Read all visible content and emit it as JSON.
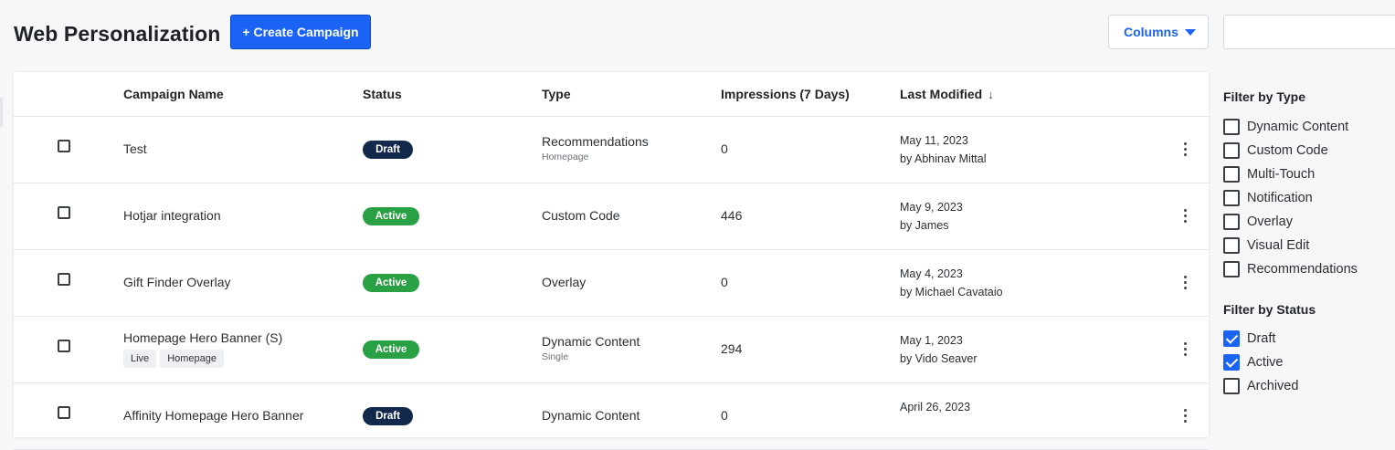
{
  "header": {
    "title": "Web Personalization",
    "create_label": "+ Create Campaign",
    "columns_label": "Columns",
    "search": {
      "value": "",
      "placeholder": ""
    }
  },
  "table": {
    "columns": {
      "name": "Campaign Name",
      "status": "Status",
      "type": "Type",
      "impressions": "Impressions (7 Days)",
      "modified": "Last Modified"
    },
    "sort_icon": "arrow-down-icon",
    "rows": [
      {
        "name": "Test",
        "status": "Draft",
        "type": "Recommendations",
        "subtype": "Homepage",
        "impressions": "0",
        "date": "May 11, 2023",
        "by": "by Abhinav Mittal",
        "tags": []
      },
      {
        "name": "Hotjar integration",
        "status": "Active",
        "type": "Custom Code",
        "subtype": "",
        "impressions": "446",
        "date": "May 9, 2023",
        "by": "by James",
        "tags": []
      },
      {
        "name": "Gift Finder Overlay",
        "status": "Active",
        "type": "Overlay",
        "subtype": "",
        "impressions": "0",
        "date": "May 4, 2023",
        "by": "by Michael Cavataio",
        "tags": []
      },
      {
        "name": "Homepage Hero Banner (S)",
        "status": "Active",
        "type": "Dynamic Content",
        "subtype": "Single",
        "impressions": "294",
        "date": "May 1, 2023",
        "by": "by Vido Seaver",
        "tags": [
          "Live",
          "Homepage"
        ]
      },
      {
        "name": "Affinity Homepage Hero Banner",
        "status": "Draft",
        "type": "Dynamic Content",
        "subtype": "",
        "impressions": "0",
        "date": "April 26, 2023",
        "by": "",
        "tags": []
      }
    ]
  },
  "filters": {
    "type_title": "Filter by Type",
    "types": [
      {
        "label": "Dynamic Content",
        "checked": false
      },
      {
        "label": "Custom Code",
        "checked": false
      },
      {
        "label": "Multi-Touch",
        "checked": false
      },
      {
        "label": "Notification",
        "checked": false
      },
      {
        "label": "Overlay",
        "checked": false
      },
      {
        "label": "Visual Edit",
        "checked": false
      },
      {
        "label": "Recommendations",
        "checked": false
      }
    ],
    "status_title": "Filter by Status",
    "statuses": [
      {
        "label": "Draft",
        "checked": true
      },
      {
        "label": "Active",
        "checked": true
      },
      {
        "label": "Archived",
        "checked": false
      }
    ]
  },
  "colors": {
    "primary": "#1b63f5",
    "draft_badge": "#13294b",
    "active_badge": "#2aa044"
  }
}
